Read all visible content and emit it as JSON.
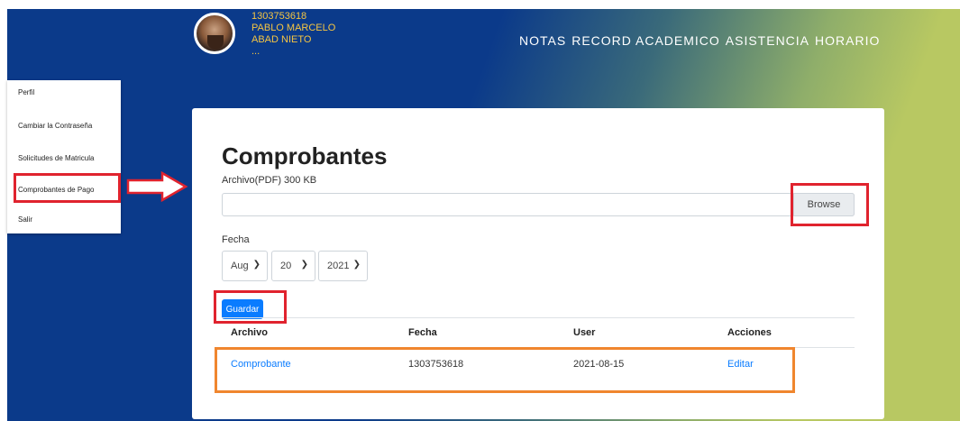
{
  "user": {
    "id": "1303753618",
    "first_name": "PABLO MARCELO",
    "last_name": "ABAD NIETO",
    "more": "..."
  },
  "nav": {
    "items": [
      "NOTAS",
      "RECORD ACADEMICO",
      "ASISTENCIA",
      "HORARIO"
    ]
  },
  "sidebar": {
    "items": [
      {
        "label": "Perfil"
      },
      {
        "label": "Cambiar la Contraseña"
      },
      {
        "label": "Solicitudes de Matricula"
      },
      {
        "label": "Comprobantes de Pago"
      },
      {
        "label": "Salir"
      }
    ]
  },
  "form": {
    "title": "Comprobantes",
    "file_label": "Archivo(PDF) 300 KB",
    "file_value": "",
    "browse_label": "Browse",
    "date_label": "Fecha",
    "month": "Aug",
    "day": "20",
    "year": "2021",
    "save_label": "Guardar"
  },
  "table": {
    "headers": [
      "Archivo",
      "Fecha",
      "User",
      "Acciones"
    ],
    "rows": [
      {
        "archivo": "Comprobante",
        "fecha": "1303753618",
        "user": "2021-08-15",
        "accion": "Editar"
      }
    ]
  },
  "colors": {
    "highlight_red": "#e0232e",
    "highlight_orange": "#f0862e",
    "primary": "#0a7cff",
    "header_blue": "#0b3a8a",
    "header_green": "#b8c862",
    "user_text": "#f5c542"
  }
}
